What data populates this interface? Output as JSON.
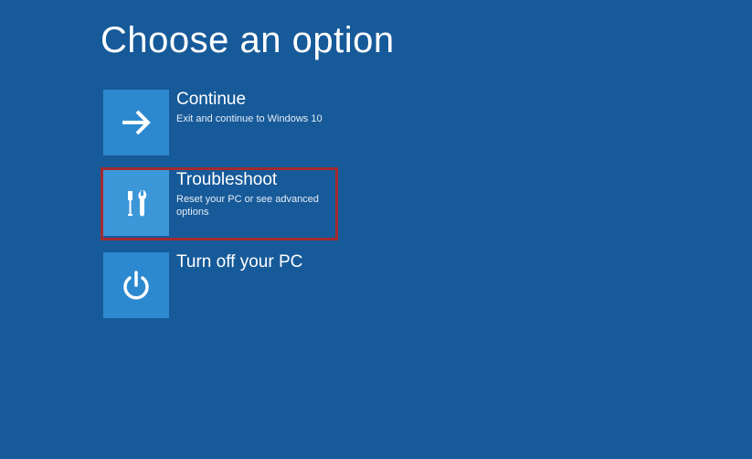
{
  "page": {
    "title": "Choose an option"
  },
  "options": [
    {
      "id": "continue",
      "title": "Continue",
      "description": "Exit and continue to Windows 10",
      "icon": "arrow-right-icon",
      "highlighted": false
    },
    {
      "id": "troubleshoot",
      "title": "Troubleshoot",
      "description": "Reset your PC or see advanced options",
      "icon": "tools-icon",
      "highlighted": true
    },
    {
      "id": "turnoff",
      "title": "Turn off your PC",
      "description": "",
      "icon": "power-icon",
      "highlighted": false
    }
  ],
  "colors": {
    "background": "#175a99",
    "tile": "#2d89cf",
    "tileHighlighted": "#3c97d8",
    "highlightBorder": "#a22b2f"
  }
}
